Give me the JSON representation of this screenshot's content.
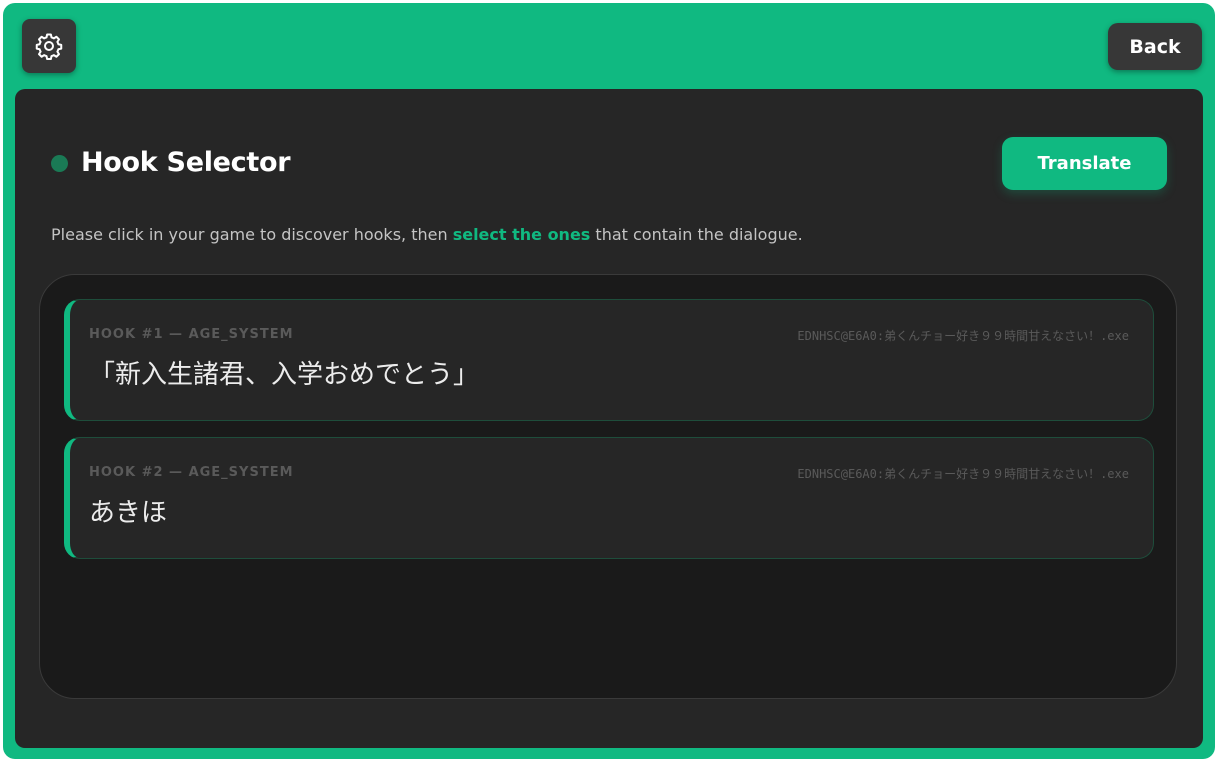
{
  "header": {
    "settings_icon": "gear-icon",
    "back_label": "Back"
  },
  "selector": {
    "title": "Hook Selector",
    "translate_label": "Translate",
    "instructions": {
      "before": "Please click in your game to discover hooks, then ",
      "highlight": "select the ones",
      "after": " that contain the dialogue."
    }
  },
  "hooks": [
    {
      "label": "HOOK #1 — AGE_SYSTEM",
      "path": "EDNHSC@E6A0:弟くんチョー好き９９時間甘えなさい！.exe",
      "text": "「新入生諸君、入学おめでとう」"
    },
    {
      "label": "HOOK #2 — AGE_SYSTEM",
      "path": "EDNHSC@E6A0:弟くんチョー好き９９時間甘えなさい！.exe",
      "text": "あきほ"
    }
  ],
  "colors": {
    "accent": "#10b981",
    "panel": "#262626",
    "list_bg": "#1a1a1a",
    "button_dark": "#373737",
    "title_dot": "#1a7a55"
  }
}
